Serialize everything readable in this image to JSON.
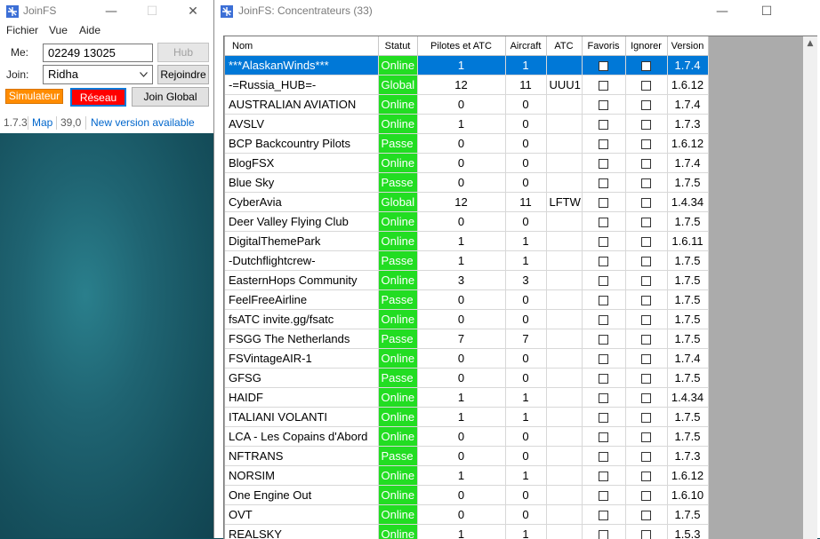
{
  "small_window": {
    "title": "JoinFS",
    "controls": {
      "minimize": "—",
      "maximize": "☐",
      "close": "✕"
    },
    "menu": [
      "Fichier",
      "Vue",
      "Aide"
    ],
    "me_label": "Me:",
    "me_value": "02249 13025",
    "hub_button": "Hub",
    "join_label": "Join:",
    "join_value": "Ridha",
    "rejoin_button": "Rejoindre",
    "simulator_button": "Simulateur",
    "network_button": "Réseau",
    "join_global_button": "Join Global",
    "status": {
      "version": "1.7.3",
      "map_link": "Map",
      "fps": "39,0",
      "update_link": "New version available"
    },
    "colors": {
      "simulator": "#ff8c00",
      "network": "#ff0000",
      "link": "#0066cc"
    }
  },
  "big_window": {
    "title": "JoinFS: Concentrateurs (33)",
    "controls": {
      "minimize": "—",
      "maximize": "☐"
    },
    "columns": [
      "Nom",
      "Statut",
      "Pilotes et ATC",
      "Aircraft",
      "ATC",
      "Favoris",
      "Ignorer",
      "Version"
    ],
    "rows": [
      {
        "name": "***AlaskanWinds***",
        "status": "Online",
        "pilots": "1",
        "aircraft": "1",
        "atc": "",
        "version": "1.7.4",
        "selected": true
      },
      {
        "name": "-=Russia_HUB=-",
        "status": "Global",
        "pilots": "12",
        "aircraft": "11",
        "atc": "UUU1",
        "version": "1.6.12"
      },
      {
        "name": "AUSTRALIAN AVIATION",
        "status": "Online",
        "pilots": "0",
        "aircraft": "0",
        "atc": "",
        "version": "1.7.4"
      },
      {
        "name": "AVSLV",
        "status": "Online",
        "pilots": "1",
        "aircraft": "0",
        "atc": "",
        "version": "1.7.3"
      },
      {
        "name": "BCP Backcountry Pilots",
        "status": "Passe",
        "pilots": "0",
        "aircraft": "0",
        "atc": "",
        "version": "1.6.12"
      },
      {
        "name": "BlogFSX",
        "status": "Online",
        "pilots": "0",
        "aircraft": "0",
        "atc": "",
        "version": "1.7.4"
      },
      {
        "name": "Blue Sky",
        "status": "Passe",
        "pilots": "0",
        "aircraft": "0",
        "atc": "",
        "version": "1.7.5"
      },
      {
        "name": "CyberAvia",
        "status": "Global",
        "pilots": "12",
        "aircraft": "11",
        "atc": "LFTW",
        "version": "1.4.34"
      },
      {
        "name": "Deer Valley Flying Club",
        "status": "Online",
        "pilots": "0",
        "aircraft": "0",
        "atc": "",
        "version": "1.7.5"
      },
      {
        "name": "DigitalThemePark",
        "status": "Online",
        "pilots": "1",
        "aircraft": "1",
        "atc": "",
        "version": "1.6.11"
      },
      {
        "name": "-Dutchflightcrew-",
        "status": "Passe",
        "pilots": "1",
        "aircraft": "1",
        "atc": "",
        "version": "1.7.5"
      },
      {
        "name": "EasternHops Community",
        "status": "Online",
        "pilots": "3",
        "aircraft": "3",
        "atc": "",
        "version": "1.7.5"
      },
      {
        "name": "FeelFreeAirline",
        "status": "Passe",
        "pilots": "0",
        "aircraft": "0",
        "atc": "",
        "version": "1.7.5"
      },
      {
        "name": "fsATC invite.gg/fsatc",
        "status": "Online",
        "pilots": "0",
        "aircraft": "0",
        "atc": "",
        "version": "1.7.5"
      },
      {
        "name": "FSGG The Netherlands",
        "status": "Passe",
        "pilots": "7",
        "aircraft": "7",
        "atc": "",
        "version": "1.7.5"
      },
      {
        "name": "FSVintageAIR-1",
        "status": "Online",
        "pilots": "0",
        "aircraft": "0",
        "atc": "",
        "version": "1.7.4"
      },
      {
        "name": "GFSG",
        "status": "Passe",
        "pilots": "0",
        "aircraft": "0",
        "atc": "",
        "version": "1.7.5"
      },
      {
        "name": "HAIDF",
        "status": "Online",
        "pilots": "1",
        "aircraft": "1",
        "atc": "",
        "version": "1.4.34"
      },
      {
        "name": "ITALIANI VOLANTI",
        "status": "Online",
        "pilots": "1",
        "aircraft": "1",
        "atc": "",
        "version": "1.7.5"
      },
      {
        "name": "LCA - Les Copains d'Abord",
        "status": "Online",
        "pilots": "0",
        "aircraft": "0",
        "atc": "",
        "version": "1.7.5"
      },
      {
        "name": "NFTRANS",
        "status": "Passe",
        "pilots": "0",
        "aircraft": "0",
        "atc": "",
        "version": "1.7.3"
      },
      {
        "name": "NORSIM",
        "status": "Online",
        "pilots": "1",
        "aircraft": "1",
        "atc": "",
        "version": "1.6.12"
      },
      {
        "name": "One Engine Out",
        "status": "Online",
        "pilots": "0",
        "aircraft": "0",
        "atc": "",
        "version": "1.6.10"
      },
      {
        "name": "OVT",
        "status": "Online",
        "pilots": "0",
        "aircraft": "0",
        "atc": "",
        "version": "1.7.5"
      },
      {
        "name": "REALSKY",
        "status": "Online",
        "pilots": "1",
        "aircraft": "1",
        "atc": "",
        "version": "1.5.3"
      }
    ],
    "colors": {
      "status": "#22dd22",
      "selection": "#0078d7",
      "background": "#ababab"
    }
  }
}
